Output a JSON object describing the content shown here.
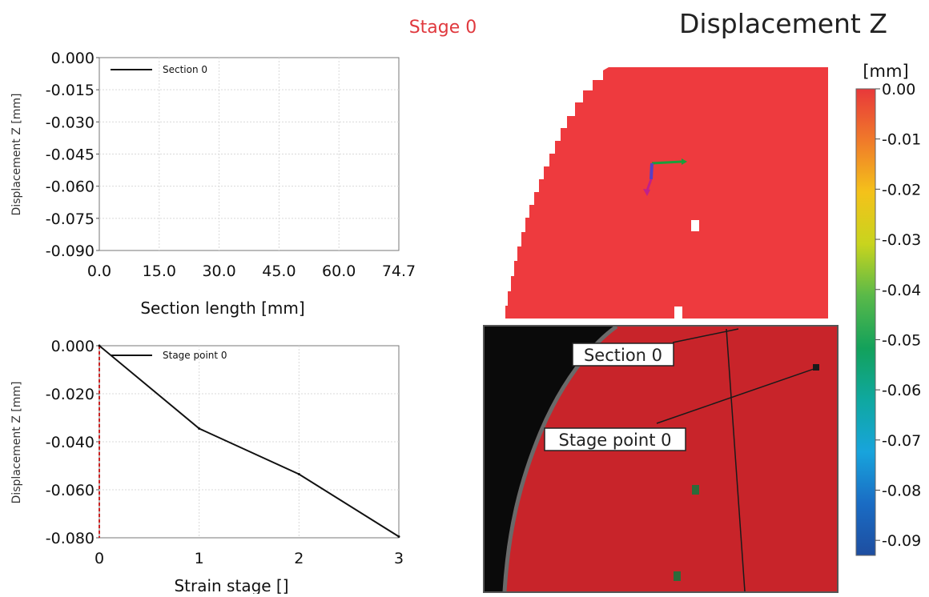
{
  "header": {
    "stage_label": "Stage 0",
    "title": "Displacement Z"
  },
  "colors": {
    "stage_label": "#e0393e",
    "surface_red": "#ee3a3e",
    "photo_red": "#c8242a",
    "photo_background": "#0a0a0a",
    "photo_frame": "#555555"
  },
  "chart_data": [
    {
      "type": "line",
      "title": "",
      "xlabel": "Section length [mm]",
      "ylabel": "Displacement Z [mm]",
      "x_ticks": [
        "0.0",
        "15.0",
        "30.0",
        "45.0",
        "60.0",
        "74.7"
      ],
      "y_ticks": [
        "0.000",
        "-0.015",
        "-0.030",
        "-0.045",
        "-0.060",
        "-0.075",
        "-0.090"
      ],
      "xlim": [
        0,
        74.7
      ],
      "ylim": [
        -0.09,
        0
      ],
      "grid": true,
      "legend_position": "top-left",
      "series": [
        {
          "name": "Section 0",
          "x": [],
          "y": []
        }
      ]
    },
    {
      "type": "line",
      "title": "",
      "xlabel": "Strain stage []",
      "ylabel": "Displacement Z [mm]",
      "x_ticks": [
        "0",
        "1",
        "2",
        "3"
      ],
      "y_ticks": [
        "0.000",
        "-0.020",
        "-0.040",
        "-0.060",
        "-0.080"
      ],
      "xlim": [
        0,
        3
      ],
      "ylim": [
        -0.08,
        0
      ],
      "grid": true,
      "legend_position": "top-left",
      "current_stage_marker": 0,
      "series": [
        {
          "name": "Stage point 0",
          "x": [
            0,
            1,
            2,
            3
          ],
          "y": [
            0.0,
            -0.0345,
            -0.0535,
            -0.0795
          ]
        }
      ]
    }
  ],
  "colorbar": {
    "unit": "[mm]",
    "ticks": [
      "0.00",
      "-0.01",
      "-0.02",
      "-0.03",
      "-0.04",
      "-0.05",
      "-0.06",
      "-0.07",
      "-0.08",
      "-0.09"
    ],
    "range": [
      -0.093,
      0
    ],
    "colors": [
      "#e8383a",
      "#f07a2a",
      "#f4c21a",
      "#c8d41e",
      "#59b949",
      "#13a15b",
      "#0fa8a0",
      "#18a4dc",
      "#1a6cc4",
      "#1e4ea0"
    ]
  },
  "overlay": {
    "section_label": "Section 0",
    "stage_point_label": "Stage point 0"
  }
}
